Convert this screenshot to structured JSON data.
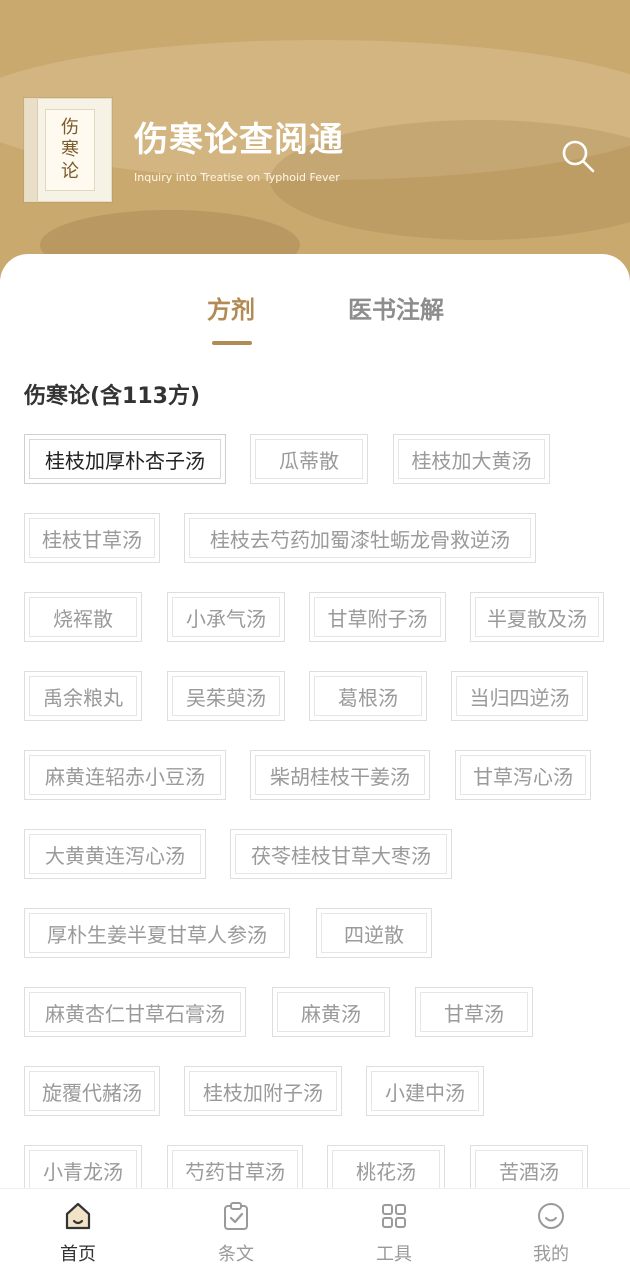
{
  "header": {
    "title": "伤寒论查阅通",
    "subtitle": "Inquiry into Treatise on Typhoid Fever",
    "logo_text": "伤寒论"
  },
  "tabs": [
    {
      "label": "方剂",
      "active": true
    },
    {
      "label": "医书注解",
      "active": false
    }
  ],
  "section": {
    "title": "伤寒论(含113方)"
  },
  "formulas": [
    "桂枝加厚朴杏子汤",
    "瓜蒂散",
    "桂枝加大黄汤",
    "桂枝甘草汤",
    "桂枝去芍药加蜀漆牡蛎龙骨救逆汤",
    "烧裈散",
    "小承气汤",
    "甘草附子汤",
    "半夏散及汤",
    "禹余粮丸",
    "吴茱萸汤",
    "葛根汤",
    "当归四逆汤",
    "麻黄连轺赤小豆汤",
    "柴胡桂枝干姜汤",
    "甘草泻心汤",
    "大黄黄连泻心汤",
    "茯苓桂枝甘草大枣汤",
    "厚朴生姜半夏甘草人参汤",
    "四逆散",
    "麻黄杏仁甘草石膏汤",
    "麻黄汤",
    "甘草汤",
    "旋覆代赭汤",
    "桂枝加附子汤",
    "小建中汤",
    "小青龙汤",
    "芍药甘草汤",
    "桃花汤",
    "苦酒汤"
  ],
  "bottom_nav": [
    {
      "label": "首页",
      "icon": "home-icon",
      "active": true
    },
    {
      "label": "条文",
      "icon": "clipboard-check-icon",
      "active": false
    },
    {
      "label": "工具",
      "icon": "grid-icon",
      "active": false
    },
    {
      "label": "我的",
      "icon": "smiley-icon",
      "active": false
    }
  ],
  "colors": {
    "header_bg": "#c9a96e",
    "accent": "#b28a54",
    "chip_text": "#9a9a9a",
    "chip_selected_text": "#222222"
  }
}
